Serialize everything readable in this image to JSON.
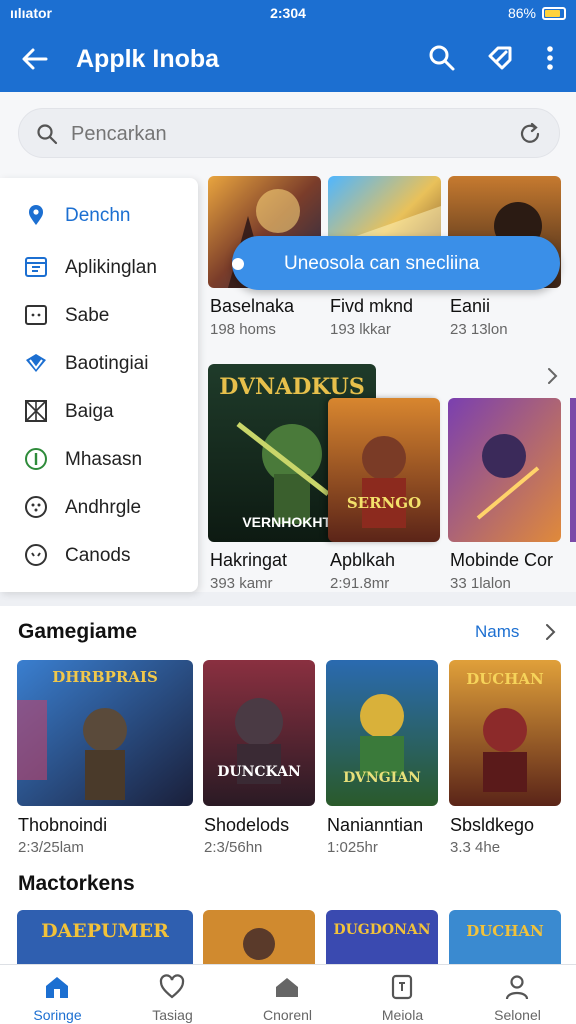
{
  "status": {
    "carrier": "ıılıator",
    "time": "2:304",
    "battery": "86%"
  },
  "appbar": {
    "title": "Applk Inoba"
  },
  "search": {
    "placeholder": "Pencarkan"
  },
  "drawer": {
    "items": [
      {
        "label": "Denchn",
        "icon": "location-icon"
      },
      {
        "label": "Aplikinglan",
        "icon": "app-grid-icon"
      },
      {
        "label": "Sabe",
        "icon": "chat-box-icon"
      },
      {
        "label": "Baotingiai",
        "icon": "diamond-icon"
      },
      {
        "label": "Baiga",
        "icon": "cross-box-icon"
      },
      {
        "label": "Mhasasn",
        "icon": "info-circle-icon"
      },
      {
        "label": "Andhrgle",
        "icon": "dots-circle-icon"
      },
      {
        "label": "Canods",
        "icon": "face-circle-icon"
      }
    ]
  },
  "toast": {
    "text": "Uneosola can snecliina"
  },
  "row1": [
    {
      "name": "Baselnaka",
      "sub": "198 homs"
    },
    {
      "name": "Fivd mknd",
      "sub": "193 lkkar"
    },
    {
      "name": "Eanii",
      "sub": "23 13lon"
    }
  ],
  "row2": [
    {
      "name": "Hakringat",
      "sub": "393 kamr",
      "art_title": "DVNADKUS",
      "art_caption": "VERNHOKHTO"
    },
    {
      "name": "Apblkah",
      "sub": "2:91.8mr",
      "art_title": "SERNGO"
    },
    {
      "name": "Mobinde Cor",
      "sub": "33 1lalon"
    }
  ],
  "gamegiame": {
    "title": "Gamegiame",
    "link": "Nams",
    "items": [
      {
        "name": "Thobnoindi",
        "sub": "2:3/25lam",
        "art_title": "DHRBPRAIS"
      },
      {
        "name": "Shodelods",
        "sub": "2:3/56hn",
        "art_title": "DUNCKAN"
      },
      {
        "name": "Nanianntian",
        "sub": "1:025hr",
        "art_title": "DVNGIAN"
      },
      {
        "name": "Sbsldkego",
        "sub": "3.3 4he",
        "art_title": "DUCHAN"
      }
    ]
  },
  "mactorkens": {
    "title": "Mactorkens",
    "items": [
      {
        "art_title": "DAEPUMER"
      },
      {
        "art_title": ""
      },
      {
        "art_title": "DUGDONAN"
      },
      {
        "art_title": "DUCHAN"
      }
    ]
  },
  "bottomnav": [
    {
      "label": "Soringe",
      "icon": "home-icon"
    },
    {
      "label": "Tasiag",
      "icon": "heart-icon"
    },
    {
      "label": "Cnorenl",
      "icon": "house-icon"
    },
    {
      "label": "Meiola",
      "icon": "tablet-icon"
    },
    {
      "label": "Selonel",
      "icon": "person-icon"
    }
  ],
  "colors": {
    "brand": "#1c6fd1",
    "toast": "#3a8fe8"
  }
}
